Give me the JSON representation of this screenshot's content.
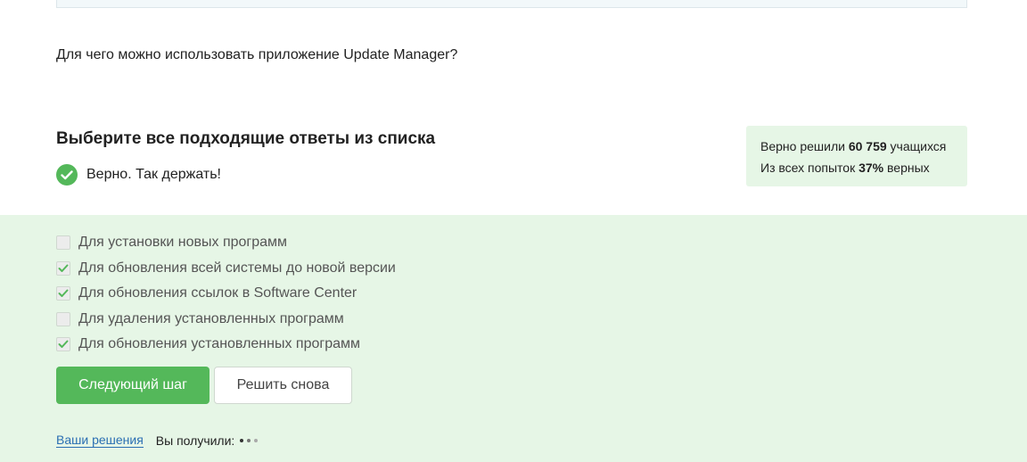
{
  "question": "Для чего можно использовать приложение Update Manager?",
  "heading": "Выберите все подходящие ответы из списка",
  "feedback": {
    "text": "Верно. Так держать!",
    "icon": "check-circle-icon",
    "color": "#54b85a"
  },
  "stats": {
    "line1_prefix": "Верно решили ",
    "solved_count": "60 759",
    "line1_suffix": " учащихся",
    "line2_prefix": "Из всех попыток ",
    "percent": "37%",
    "line2_suffix": " верных"
  },
  "options": [
    {
      "label": "Для установки новых программ",
      "checked": false
    },
    {
      "label": "Для обновления всей системы до новой версии",
      "checked": true
    },
    {
      "label": "Для обновления ссылок в Software Center",
      "checked": true
    },
    {
      "label": "Для удаления установленных программ",
      "checked": false
    },
    {
      "label": "Для обновления установленных программ",
      "checked": true
    }
  ],
  "buttons": {
    "next": "Следующий шаг",
    "retry": "Решить снова"
  },
  "footer": {
    "solutions_link": "Ваши решения",
    "received_label": "Вы получили:"
  },
  "colors": {
    "accent": "#54b85a",
    "answers_background": "#e6f6e6",
    "link": "#2b6fb3"
  }
}
